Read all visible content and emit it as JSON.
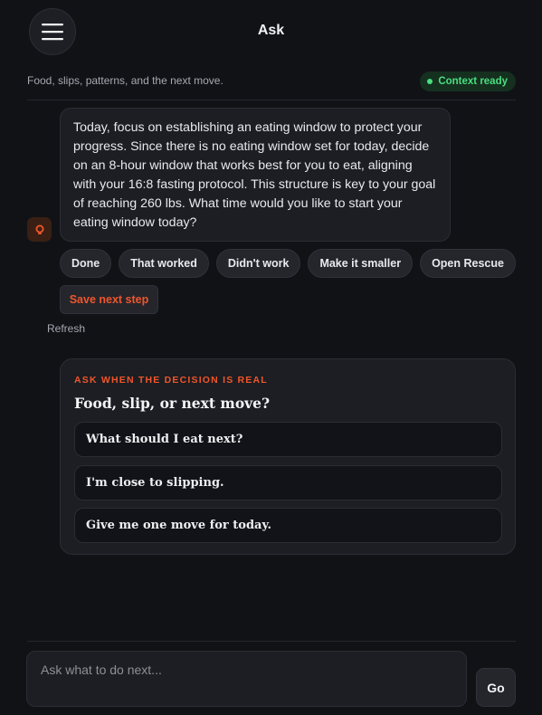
{
  "header": {
    "title": "Ask",
    "menu_icon": "hamburger-menu-icon",
    "subtitle": "Food, slips, patterns, and the next move.",
    "context_badge": "Context ready"
  },
  "message": {
    "avatar_icon": "bulb-icon",
    "text": "Today, focus on establishing an eating window to protect your progress. Since there is no eating window set for today, decide on an 8-hour window that works best for you to eat, aligning with your 16:8 fasting protocol. This structure is key to your goal of reaching 260 lbs. What time would you like to start your eating window today?"
  },
  "actions": {
    "chips": [
      "Done",
      "That worked",
      "Didn't work",
      "Make it smaller",
      "Open Rescue"
    ],
    "save_label": "Save next step",
    "refresh_label": "Refresh"
  },
  "ask_card": {
    "eyebrow": "ASK WHEN THE DECISION IS REAL",
    "heading": "Food, slip, or next move?",
    "prompts": [
      "What should I eat next?",
      "I'm close to slipping.",
      "Give me one move for today."
    ]
  },
  "composer": {
    "placeholder": "Ask what to do next...",
    "value": "",
    "send_label": "Go"
  },
  "colors": {
    "background": "#111216",
    "card": "#1c1e23",
    "accent": "#f0552b",
    "status_green": "#4ade80"
  }
}
